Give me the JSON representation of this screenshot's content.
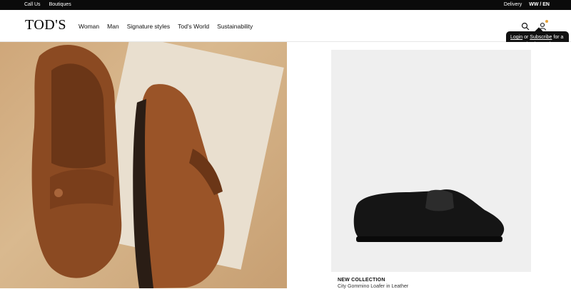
{
  "topbar": {
    "links": [
      "Call Us",
      "Boutiques"
    ],
    "delivery": "Delivery",
    "lang": "WW / EN"
  },
  "header": {
    "logo": "TOD'S",
    "menu": [
      "Woman",
      "Man",
      "Signature styles",
      "Tod's World",
      "Sustainability"
    ]
  },
  "tooltip": {
    "login": "Login",
    "or": "or",
    "subscribe": "Subscribe",
    "rest": "for a customized experience."
  },
  "product": {
    "tag": "NEW COLLECTION",
    "name": "City Gommino Loafer in Leather"
  },
  "colors": {
    "topbar": "#0b0b0b",
    "accent_dot": "#e6a33a",
    "leather": "#8b4a22"
  },
  "icons": [
    "search-icon",
    "user-icon"
  ]
}
